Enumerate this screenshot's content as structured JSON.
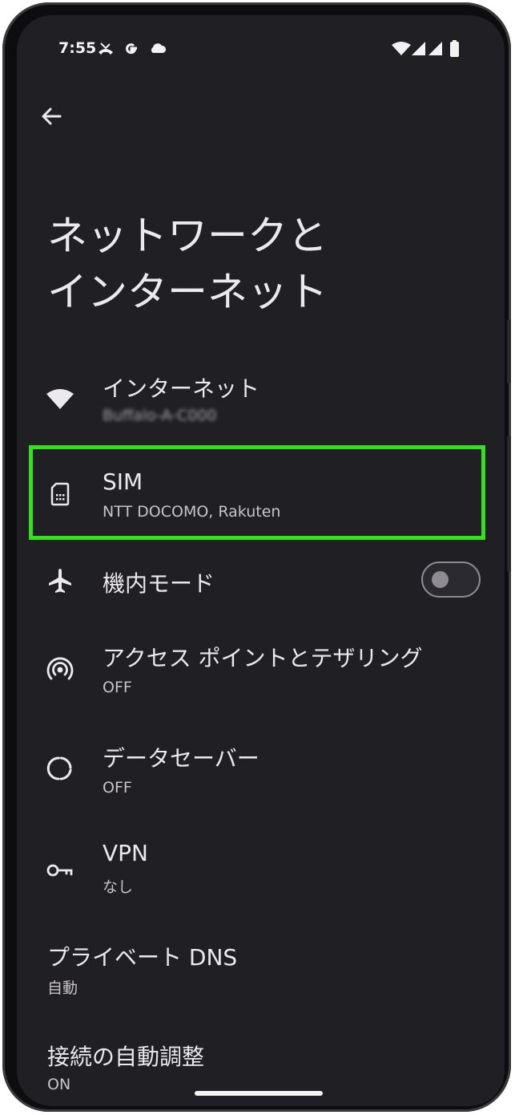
{
  "status_bar": {
    "time": "7:55",
    "left_icons": [
      "missed-call-icon",
      "google-icon",
      "cloud-icon"
    ],
    "right_icons": [
      "wifi-icon",
      "signal-icon",
      "signal-icon",
      "battery-icon"
    ]
  },
  "header": {
    "back_icon": "arrow-back-icon",
    "title_line1": "ネットワークと",
    "title_line2": "インターネット"
  },
  "items": [
    {
      "icon": "wifi-icon",
      "label": "インターネット",
      "sub": "Buffalo-A-C000"
    },
    {
      "icon": "sim-card-icon",
      "label": "SIM",
      "sub": "NTT DOCOMO, Rakuten"
    },
    {
      "icon": "airplane-icon",
      "label": "機内モード",
      "toggle": "off"
    },
    {
      "icon": "hotspot-icon",
      "label": "アクセス ポイントとテザリング",
      "sub": "OFF"
    },
    {
      "icon": "data-saver-icon",
      "label": "データセーバー",
      "sub": "OFF"
    },
    {
      "icon": "vpn-key-icon",
      "label": "VPN",
      "sub": "なし"
    },
    {
      "label": "プライベート DNS",
      "sub": "自動"
    },
    {
      "label": "接続の自動調整",
      "sub": "ON"
    }
  ],
  "colors": {
    "background": "#1f1f24",
    "highlight": "#35e01d",
    "text": "#ece9ee"
  }
}
